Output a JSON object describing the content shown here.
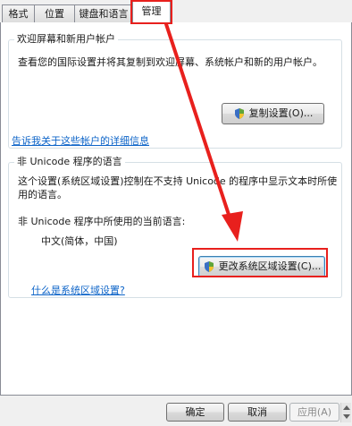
{
  "tabs": [
    {
      "label": "格式"
    },
    {
      "label": "位置"
    },
    {
      "label": "键盘和语言"
    },
    {
      "label": "管理"
    }
  ],
  "welcome": {
    "legend": "欢迎屏幕和新用户帐户",
    "description": "查看您的国际设置并将其复制到欢迎屏幕、系统帐户和新的用户帐户。",
    "copy_button": "复制设置(O)...",
    "link": "告诉我关于这些帐户的详细信息"
  },
  "nonunicode": {
    "legend": "非 Unicode 程序的语言",
    "description_line1": "这个设置(系统区域设置)控制在不支持 Unicode 的程序中显示文本时所使",
    "description_line2": "用的语言。",
    "current_label": "非 Unicode 程序中所使用的当前语言:",
    "current_value": "中文(简体，中国)",
    "change_button": "更改系统区域设置(C)...",
    "link": "什么是系统区域设置?"
  },
  "footer": {
    "ok": "确定",
    "cancel": "取消",
    "apply": "应用(A)"
  },
  "colors": {
    "annotation": "#e8201d",
    "link": "#0d64c8"
  }
}
